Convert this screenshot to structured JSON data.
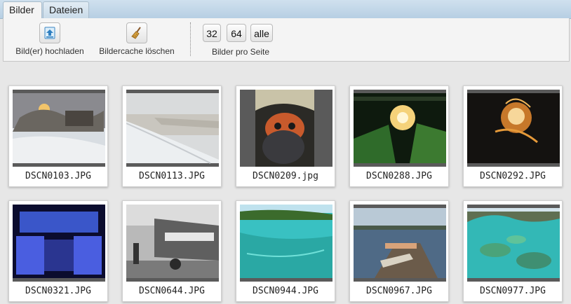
{
  "tabs": [
    {
      "label": "Bilder",
      "active": true
    },
    {
      "label": "Dateien",
      "active": false
    }
  ],
  "toolbar": {
    "upload": {
      "label": "Bild(er) hochladen",
      "icon": "upload-icon"
    },
    "clear_cache": {
      "label": "Bildercache löschen",
      "icon": "broom-icon"
    },
    "per_page": {
      "options": [
        "32",
        "64",
        "alle"
      ],
      "label": "Bilder pro Seite"
    }
  },
  "images": [
    {
      "filename": "DSCN0103.JPG"
    },
    {
      "filename": "DSCN0113.JPG"
    },
    {
      "filename": "DSCN0209.jpg"
    },
    {
      "filename": "DSCN0288.JPG"
    },
    {
      "filename": "DSCN0292.JPG"
    },
    {
      "filename": "DSCN0321.JPG"
    },
    {
      "filename": "DSCN0644.JPG"
    },
    {
      "filename": "DSCN0944.JPG"
    },
    {
      "filename": "DSCN0967.JPG"
    },
    {
      "filename": "DSCN0977.JPG"
    }
  ],
  "colors": {
    "tab_bar": "#b7cfe3",
    "toolbar_bg": "#f4f4f4",
    "page_bg": "#e7e7e7"
  }
}
